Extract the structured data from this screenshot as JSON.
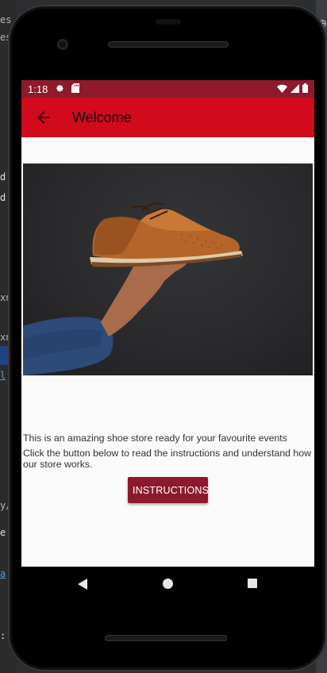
{
  "ide": {
    "fragments": [
      "es",
      "es",
      "d.",
      "d.x",
      "xn",
      "xn",
      "l",
      "y/z",
      "e",
      "a",
      ":"
    ]
  },
  "status_bar": {
    "time": "1:18",
    "icons": [
      "settings-icon",
      "sd-card-icon",
      "wifi-icon",
      "signal-icon",
      "battery-icon"
    ]
  },
  "app_bar": {
    "title": "Welcome",
    "back_icon": "arrow-back-icon"
  },
  "content": {
    "line1": "This is an amazing shoe store ready for your favourite events",
    "line2": "Click the button below to read the instructions and understand how our store works.",
    "button_label": "INSTRUCTIONS"
  },
  "nav_bar": {
    "icons": [
      "back-triangle-icon",
      "home-circle-icon",
      "recents-square-icon"
    ]
  },
  "colors": {
    "status_bar": "#8e1a2c",
    "app_bar": "#d10b1c",
    "button": "#8b1a2d"
  }
}
